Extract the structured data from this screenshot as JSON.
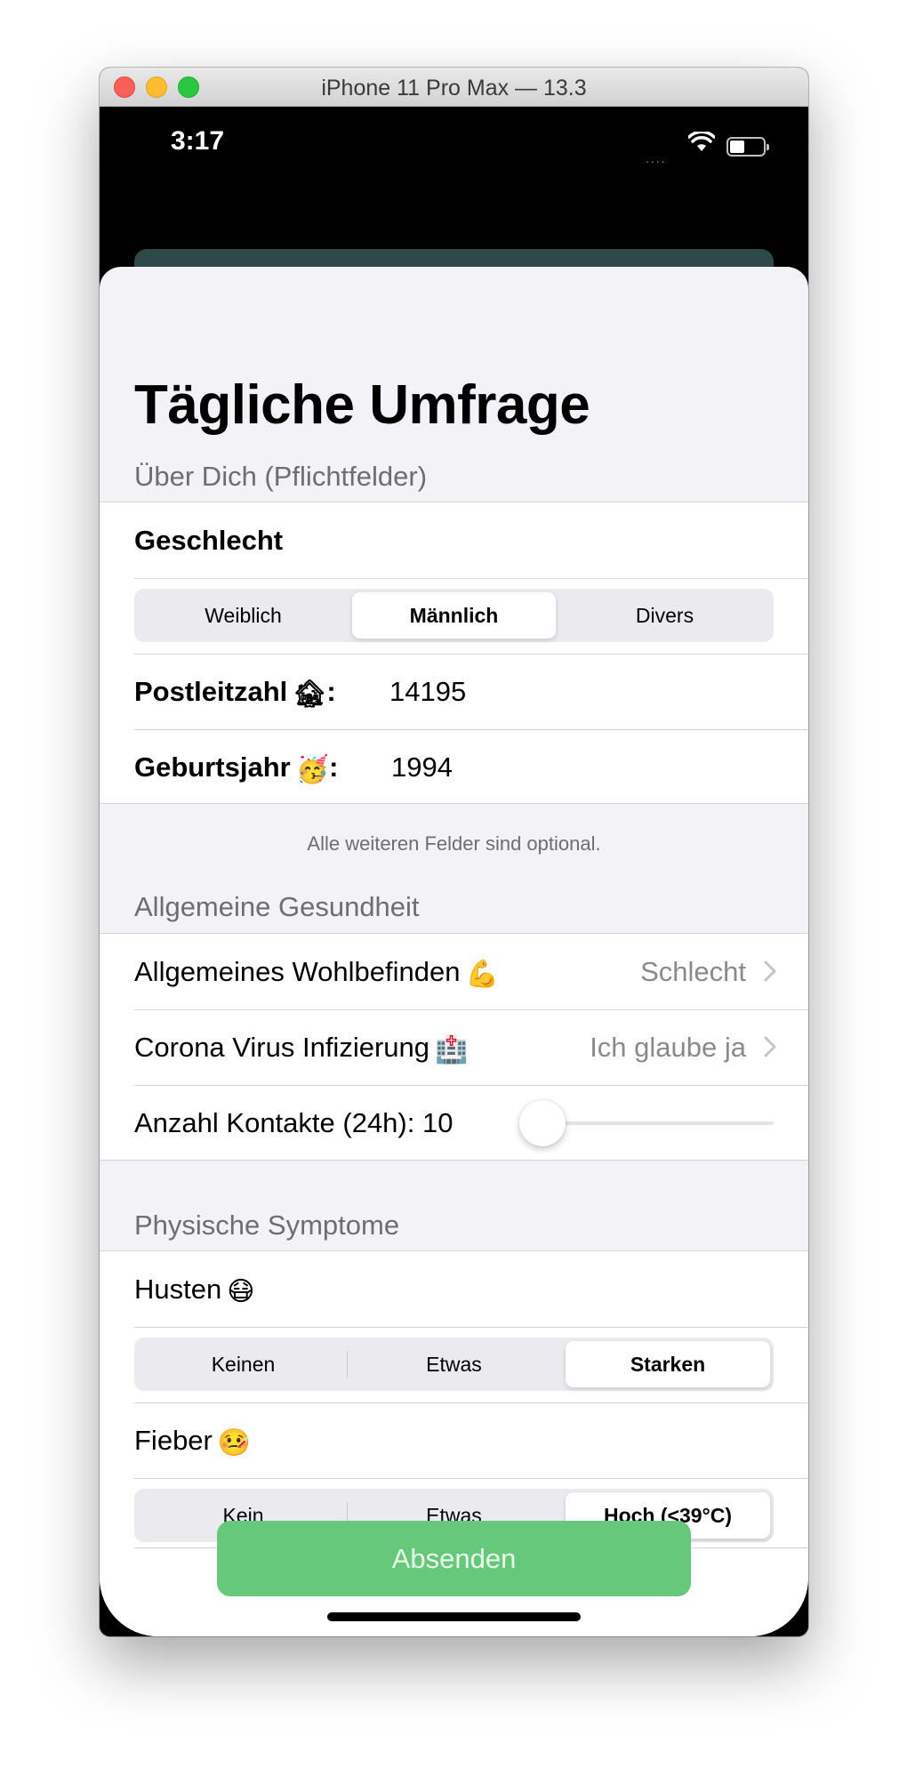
{
  "window": {
    "title": "iPhone 11 Pro Max — 13.3"
  },
  "status_bar": {
    "time": "3:17",
    "signal": "....",
    "battery_level": 0.45
  },
  "page": {
    "title": "Tägliche Umfrage",
    "about_section": {
      "header": "Über Dich (Pflichtfelder)",
      "gender_label": "Geschlecht",
      "gender_options": [
        "Weiblich",
        "Männlich",
        "Divers"
      ],
      "gender_selected": "Männlich",
      "postal_label": "Postleitzahl",
      "postal_emoji": "🏚",
      "postal_value": "14195",
      "birthyear_label": "Geburtsjahr",
      "birthyear_emoji": "🥳",
      "birthyear_value": "1994",
      "colon": ":",
      "footer": "Alle weiteren Felder sind optional."
    },
    "health_section": {
      "header": "Allgemeine Gesundheit",
      "wellbeing_label": "Allgemeines Wohlbefinden",
      "wellbeing_emoji": "💪",
      "wellbeing_value": "Schlecht",
      "infection_label": "Corona Virus Infizierung",
      "infection_emoji": "🏥",
      "infection_value": "Ich glaube ja",
      "contacts_label": "Anzahl Kontakte (24h): 10",
      "contacts_value": 10
    },
    "symptoms_section": {
      "header": "Physische Symptome",
      "cough_label": "Husten",
      "cough_emoji": "😷",
      "cough_options": [
        "Keinen",
        "Etwas",
        "Starken"
      ],
      "cough_selected": "Starken",
      "fever_label": "Fieber",
      "fever_emoji": "🤒",
      "fever_options": [
        "Kein",
        "Etwas",
        "Hoch (<39°C)"
      ],
      "fever_selected": "Hoch (<39°C)"
    },
    "submit_label": "Absenden"
  },
  "colors": {
    "accent_green": "#66c97a",
    "section_background": "#f2f2f7",
    "secondary_text": "#8a8a8e",
    "slider_min": "#007aff"
  }
}
